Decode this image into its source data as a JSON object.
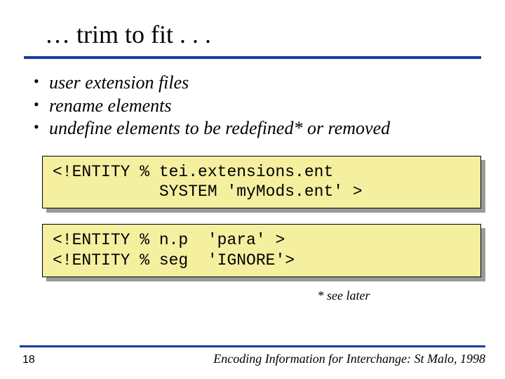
{
  "title": "… trim to fit . . .",
  "bullets": [
    "user extension files",
    "rename elements",
    "undefine elements to be redefined* or removed"
  ],
  "code_blocks": [
    "<!ENTITY % tei.extensions.ent\n           SYSTEM 'myMods.ent' >",
    "<!ENTITY % n.p  'para' >\n<!ENTITY % seg  'IGNORE'>"
  ],
  "note": "* see later",
  "footer": {
    "page": "18",
    "text": "Encoding Information for Interchange: St Malo, 1998"
  }
}
